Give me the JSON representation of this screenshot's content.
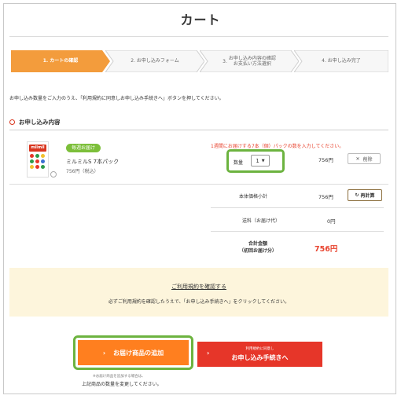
{
  "header": {
    "title": "カート"
  },
  "steps": [
    {
      "label": "1. カートの確認",
      "active": true
    },
    {
      "label": "2. お申し込みフォーム",
      "active": false
    },
    {
      "label_prefix": "3.",
      "label_line1": "お申し込み内容の確認",
      "label_line2": "お支払い方法選択",
      "active": false
    },
    {
      "label": "4. お申し込み完了",
      "active": false
    }
  ],
  "notice": "お申し込み数量をご入力のうえ、「利用規約に同意しお申し込み手続きへ」ボタンを押してください。",
  "section": {
    "heading": "お申し込み内容"
  },
  "instruction": "1週間にお届けする7本（個）パックの数を入力してください。",
  "product": {
    "tag": "毎週お届け",
    "name": "ミルミルS 7本パック",
    "price": "756円（税込）",
    "package_brand": "milmil"
  },
  "quantity": {
    "label": "数量",
    "value": "1"
  },
  "unit_price": "756円",
  "delete_label": "削除",
  "summary": {
    "subtotal_label": "本体価格小計",
    "subtotal_value": "756円",
    "recalc_label": "再計算",
    "shipping_label": "送料（お届け代）",
    "shipping_value": "0円",
    "total_label_line1": "合計金額",
    "total_label_line2": "（初回お届け分）",
    "total_value": "756円"
  },
  "terms": {
    "link": "ご利用規約を確認する",
    "note": "必ずご利用規約を確認したうえで、「お申し込み手続きへ」をクリックしてください。"
  },
  "buttons": {
    "add": "お届け商品の追加",
    "proceed_small": "利用規約に同意し",
    "proceed_main": "お申し込み手続きへ"
  },
  "add_note_line1": "※お届け商品を追加する場合は、",
  "add_note_line2": "上記商品の数量を変更してください。",
  "colors": {
    "accent_orange": "#ff7f1f",
    "accent_red": "#e63629",
    "highlight_green": "#6cb33f",
    "terms_bg": "#fdf5dc"
  },
  "icons": {
    "section": "circle-marker-icon",
    "qty": "chevron-down-icon",
    "delete": "x-icon",
    "recalc": "refresh-icon",
    "buttons": "chevron-right-icon"
  }
}
